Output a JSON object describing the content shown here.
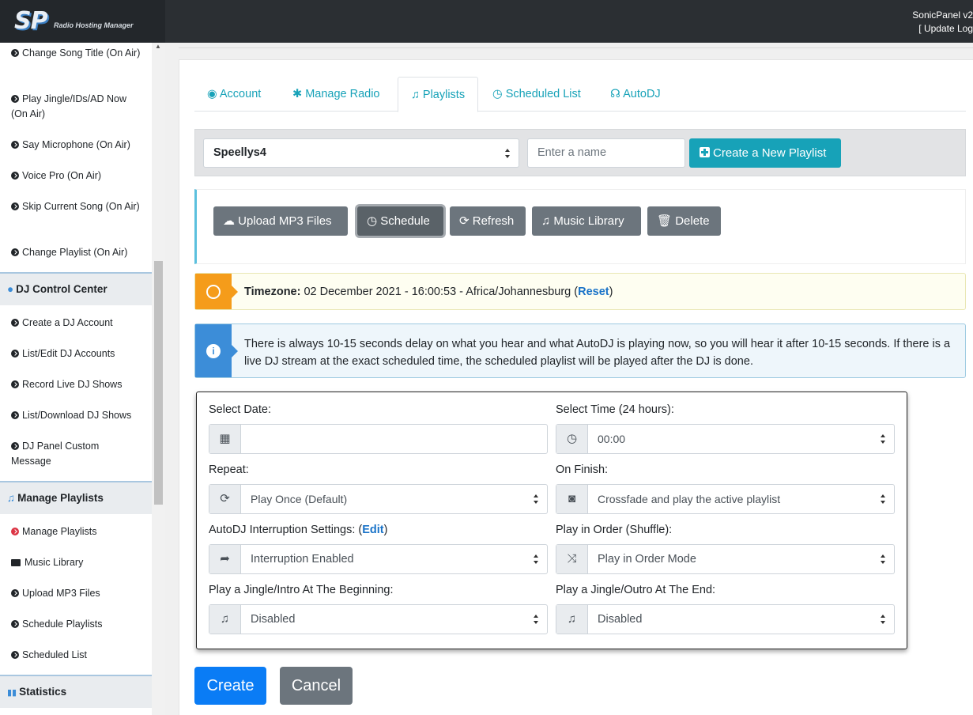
{
  "header": {
    "logo_text": "SP",
    "logo_sub": "Radio Hosting Manager",
    "app_version": "SonicPanel v2",
    "update_log": "[ Update Log"
  },
  "sidebar": {
    "items_top": [
      {
        "label": "Change Song Title (On Air)"
      },
      {
        "label": "Play Jingle/IDs/AD Now (On Air)"
      },
      {
        "label": "Say Microphone (On Air)"
      },
      {
        "label": "Voice Pro (On Air)"
      },
      {
        "label": "Skip Current Song (On Air)"
      },
      {
        "label": "Change Playlist (On Air)"
      }
    ],
    "dj_header": "DJ Control Center",
    "dj_items": [
      {
        "label": "Create a DJ Account"
      },
      {
        "label": "List/Edit DJ Accounts"
      },
      {
        "label": "Record Live DJ Shows"
      },
      {
        "label": "List/Download DJ Shows"
      },
      {
        "label": "DJ Panel Custom Message"
      }
    ],
    "playlists_header": "Manage Playlists",
    "playlist_items": [
      {
        "label": "Manage Playlists"
      },
      {
        "label": "Music Library"
      },
      {
        "label": "Upload MP3 Files"
      },
      {
        "label": "Schedule Playlists"
      },
      {
        "label": "Scheduled List"
      }
    ],
    "stats_header": "Statistics"
  },
  "tabs": [
    {
      "label": "Account",
      "icon": "user-circle-icon"
    },
    {
      "label": "Manage Radio",
      "icon": "gear-icon"
    },
    {
      "label": "Playlists",
      "icon": "music-icon",
      "active": true
    },
    {
      "label": "Scheduled List",
      "icon": "clock-icon"
    },
    {
      "label": "AutoDJ",
      "icon": "headphones-icon"
    }
  ],
  "playlist_bar": {
    "selected_playlist": "Speellys4",
    "name_placeholder": "Enter a name",
    "create_label": "Create a New Playlist"
  },
  "actions": {
    "upload": "Upload MP3 Files",
    "schedule": "Schedule",
    "refresh": "Refresh",
    "library": "Music Library",
    "delete": "Delete"
  },
  "timezone": {
    "label": "Timezone:",
    "value": "02 December 2021 - 16:00:53 - Africa/Johannesburg (",
    "reset": "Reset",
    "close": ")"
  },
  "info_text": "There is always 10-15 seconds delay on what you hear and what AutoDJ is playing now, so you will hear it after 10-15 seconds. If there is a live DJ stream at the exact scheduled time, the scheduled playlist will be played after the DJ is done.",
  "form": {
    "date_label": "Select Date:",
    "date_value": "",
    "time_label": "Select Time (24 hours):",
    "time_value": "00:00",
    "repeat_label": "Repeat:",
    "repeat_value": "Play Once (Default)",
    "finish_label": "On Finish:",
    "finish_value": "Crossfade and play the active playlist",
    "interrupt_label": "AutoDJ Interruption Settings: (",
    "interrupt_edit": "Edit",
    "interrupt_close": ")",
    "interrupt_value": "Interruption Enabled",
    "order_label": "Play in Order (Shuffle):",
    "order_value": "Play in Order Mode",
    "jingle_begin_label": "Play a Jingle/Intro At The Beginning:",
    "jingle_begin_value": "Disabled",
    "jingle_end_label": "Play a Jingle/Outro At The End:",
    "jingle_end_value": "Disabled"
  },
  "buttons": {
    "create": "Create",
    "cancel": "Cancel"
  },
  "colors": {
    "teal": "#17a2b8",
    "primary": "#0a7cf5",
    "secondary": "#6c757d",
    "warning": "#f59c1a",
    "info": "#3c8dd8"
  }
}
